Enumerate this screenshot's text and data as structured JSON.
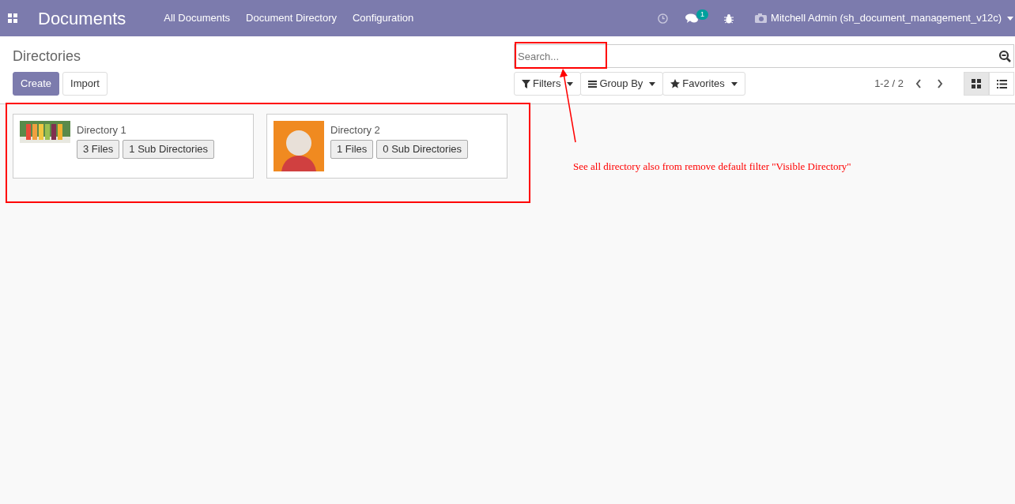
{
  "navbar": {
    "app_title": "Documents",
    "menu": [
      "All Documents",
      "Document Directory",
      "Configuration"
    ],
    "messages_badge": "1",
    "user": "Mitchell Admin (sh_document_management_v12c)"
  },
  "control_panel": {
    "breadcrumb": "Directories",
    "buttons": [
      {
        "label": "Create",
        "kind": "primary"
      },
      {
        "label": "Import",
        "kind": "secondary"
      }
    ],
    "search": {
      "placeholder": "Search..."
    },
    "search_options": [
      {
        "label": "Filters",
        "kind": "filter"
      },
      {
        "label": "Group By",
        "kind": "group"
      },
      {
        "label": "Favorites",
        "kind": "favorite"
      }
    ],
    "pager": "1-2 / 2",
    "views": [
      {
        "kind": "kanban",
        "selected": true
      },
      {
        "kind": "list",
        "selected": false
      }
    ]
  },
  "directories": [
    {
      "name": "Directory 1",
      "kind": "bottles",
      "buttons": [
        "3 Files",
        "1 Sub Directories"
      ]
    },
    {
      "name": "Directory 2",
      "kind": "avatar",
      "buttons": [
        "1 Files",
        "0 Sub Directories"
      ]
    }
  ],
  "annotation": {
    "note": "See all directory also from remove default filter \"Visible Directory\""
  }
}
